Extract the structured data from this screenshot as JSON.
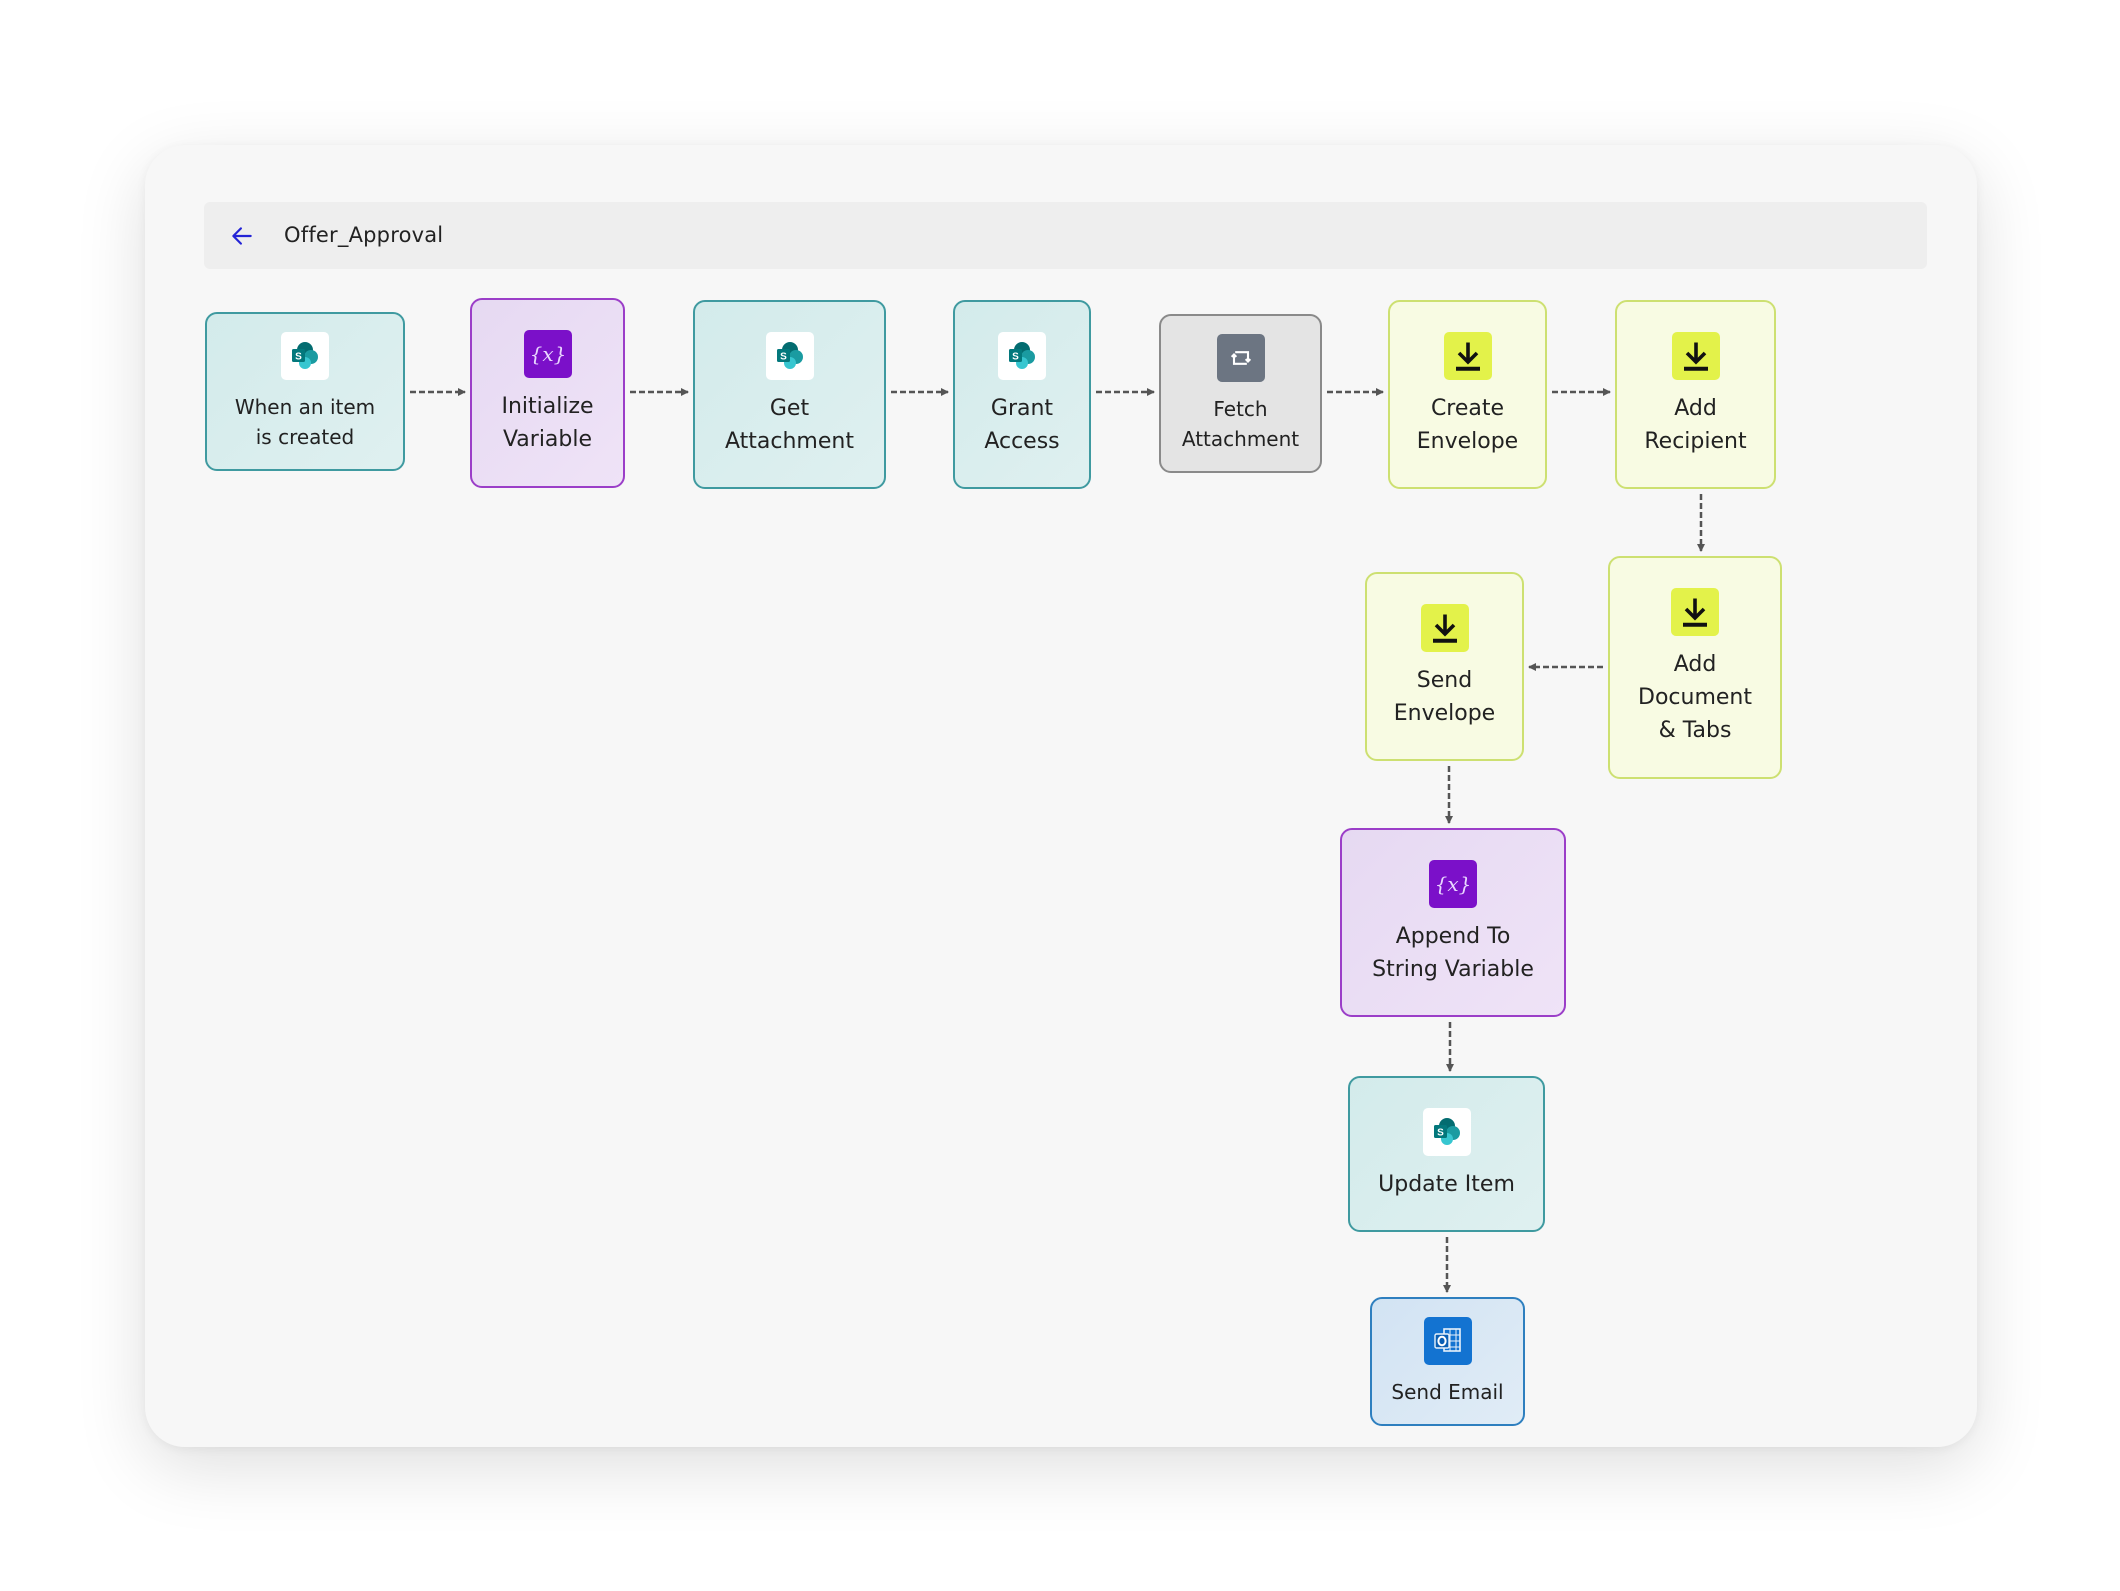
{
  "header": {
    "back_icon": "arrow-left-icon",
    "title": "Offer_Approval"
  },
  "colors": {
    "accent_back": "#2424d6",
    "sharepoint_border": "#3f9aa0",
    "variable_border": "#9b3ec8",
    "control_border": "#8a8a8a",
    "docusign_border": "#cde071",
    "outlook_border": "#2e7fbf"
  },
  "flow": {
    "nodes": [
      {
        "id": "when-item-created",
        "label": "When an item\nis created",
        "type": "sharepoint",
        "icon": "sharepoint-icon"
      },
      {
        "id": "initialize-variable",
        "label": "Initialize\nVariable",
        "type": "variable",
        "icon": "variable-icon"
      },
      {
        "id": "get-attachment",
        "label": "Get\nAttachment",
        "type": "sharepoint",
        "icon": "sharepoint-icon"
      },
      {
        "id": "grant-access",
        "label": "Grant\nAccess",
        "type": "sharepoint",
        "icon": "sharepoint-icon"
      },
      {
        "id": "fetch-attachment",
        "label": "Fetch\nAttachment",
        "type": "control",
        "icon": "loop-icon"
      },
      {
        "id": "create-envelope",
        "label": "Create\nEnvelope",
        "type": "docusign",
        "icon": "download-icon"
      },
      {
        "id": "add-recipient",
        "label": "Add\nRecipient",
        "type": "docusign",
        "icon": "download-icon"
      },
      {
        "id": "add-document-tabs",
        "label": "Add\nDocument\n& Tabs",
        "type": "docusign",
        "icon": "download-icon"
      },
      {
        "id": "send-envelope",
        "label": "Send\nEnvelope",
        "type": "docusign",
        "icon": "download-icon"
      },
      {
        "id": "append-string-variable",
        "label": "Append To\nString Variable",
        "type": "variable",
        "icon": "variable-icon"
      },
      {
        "id": "update-item",
        "label": "Update Item",
        "type": "sharepoint",
        "icon": "sharepoint-icon"
      },
      {
        "id": "send-email",
        "label": "Send Email",
        "type": "outlook",
        "icon": "outlook-icon"
      }
    ],
    "edges": [
      [
        "when-item-created",
        "initialize-variable"
      ],
      [
        "initialize-variable",
        "get-attachment"
      ],
      [
        "get-attachment",
        "grant-access"
      ],
      [
        "grant-access",
        "fetch-attachment"
      ],
      [
        "fetch-attachment",
        "create-envelope"
      ],
      [
        "create-envelope",
        "add-recipient"
      ],
      [
        "add-recipient",
        "add-document-tabs"
      ],
      [
        "add-document-tabs",
        "send-envelope"
      ],
      [
        "send-envelope",
        "append-string-variable"
      ],
      [
        "append-string-variable",
        "update-item"
      ],
      [
        "update-item",
        "send-email"
      ]
    ]
  }
}
